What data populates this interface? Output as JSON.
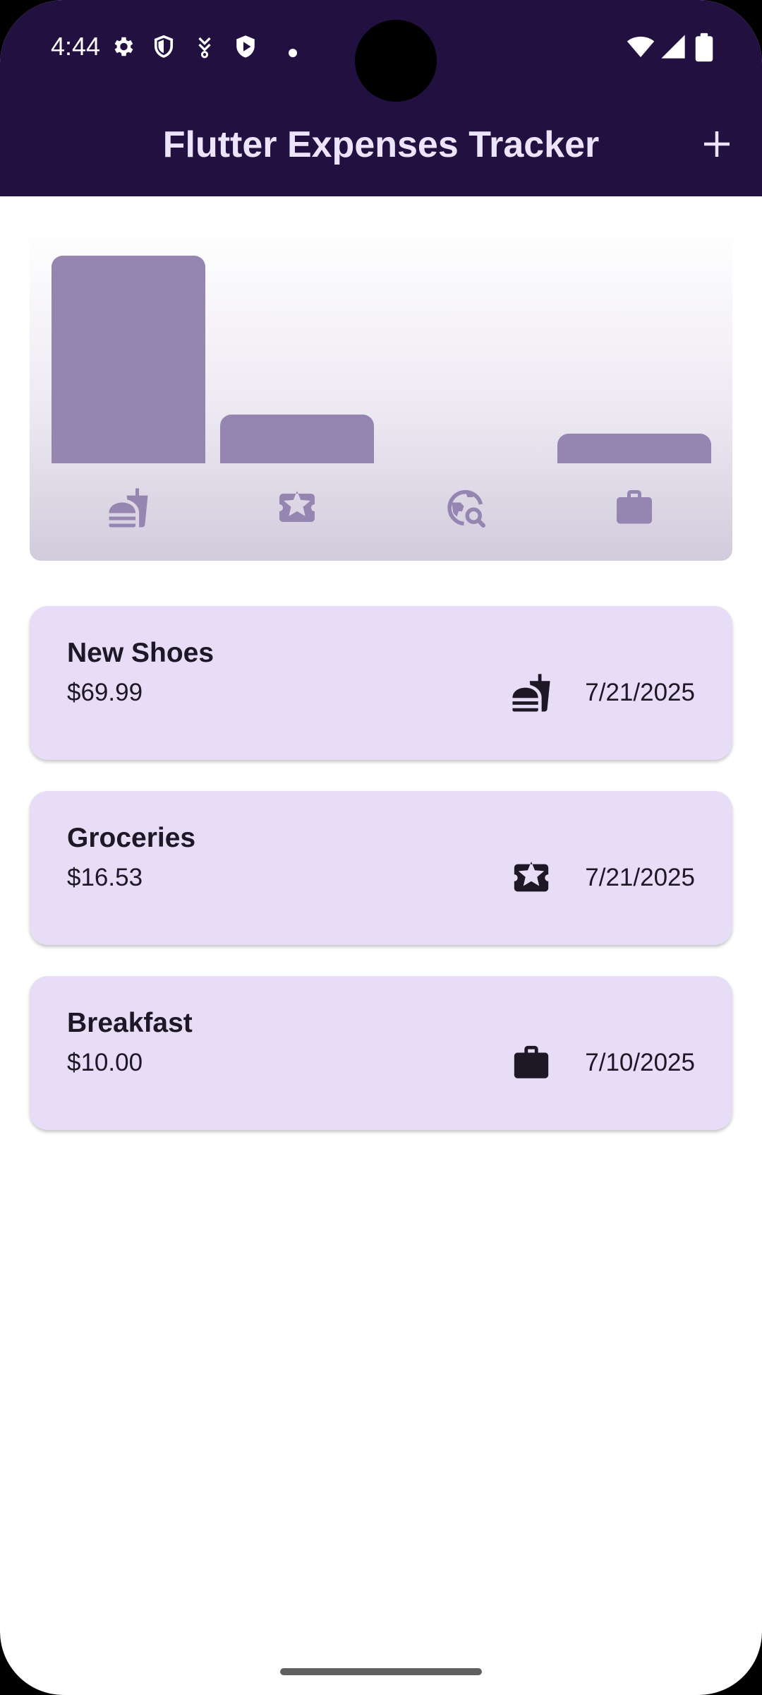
{
  "status_bar": {
    "time": "4:44",
    "left_icons": [
      "settings-icon",
      "shield-icon",
      "download-icon",
      "play-shield-icon",
      "dot-icon"
    ],
    "right_icons": [
      "wifi-icon",
      "signal-icon",
      "battery-icon"
    ]
  },
  "app_bar": {
    "title": "Flutter Expenses Tracker",
    "action_icon": "add-icon"
  },
  "colors": {
    "app_bar_bg": "#221041",
    "app_bar_fg": "#ece4fb",
    "bar_fill": "#9585b1",
    "card_bg": "#e7ddf6",
    "text": "#1d1726"
  },
  "chart_data": {
    "type": "bar",
    "categories": [
      "food-icon",
      "leisure-icon",
      "travel-icon",
      "work-icon"
    ],
    "values": [
      1.0,
      0.236,
      0.0,
      0.143
    ],
    "ylim": [
      0,
      1
    ],
    "grid": false,
    "legend": "none"
  },
  "expenses": [
    {
      "title": "New Shoes",
      "amount": "$69.99",
      "category_icon": "food-icon",
      "date": "7/21/2025"
    },
    {
      "title": "Groceries",
      "amount": "$16.53",
      "category_icon": "leisure-icon",
      "date": "7/21/2025"
    },
    {
      "title": "Breakfast",
      "amount": "$10.00",
      "category_icon": "work-icon",
      "date": "7/10/2025"
    }
  ]
}
